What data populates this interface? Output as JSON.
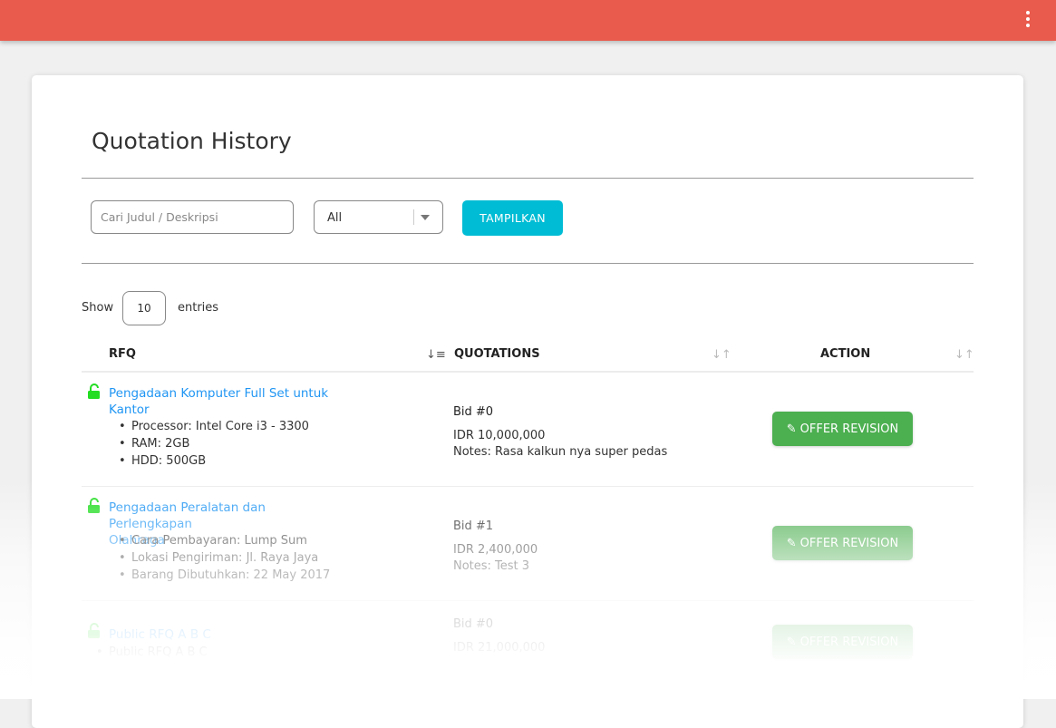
{
  "topbar": {
    "menu_icon": "kebab-menu-icon",
    "color": "#e95b4d"
  },
  "page": {
    "title": "Quotation History"
  },
  "filters": {
    "search_placeholder": "Cari Judul / Deskripsi",
    "status_select": "All",
    "submit_label": "TAMPILKAN"
  },
  "table_controls": {
    "show_label": "Show",
    "entries_value": "10",
    "entries_label": "entries"
  },
  "columns": {
    "rfq": "RFQ",
    "quotations": "QUOTATIONS",
    "action": "ACTION"
  },
  "rows": [
    {
      "rfq_title_line1": "Pengadaan Komputer Full Set untuk",
      "rfq_title_line2": "Kantor",
      "details": [
        "Processor: Intel Core i3 - 3300",
        "RAM: 2GB",
        "HDD: 500GB"
      ],
      "bid": "Bid #0",
      "amount": "IDR 10,000,000",
      "notes": "Notes: Rasa kalkun nya super pedas",
      "action": "OFFER REVISION"
    },
    {
      "rfq_title_line1": "Pengadaan Peralatan dan Perlengkapan",
      "rfq_title_line2": "Olahraga",
      "details": [
        "Cara Pembayaran: Lump Sum",
        "Lokasi Pengiriman: Jl. Raya Jaya",
        "Barang Dibutuhkan: 22 May 2017"
      ],
      "bid": "Bid #1",
      "amount": "IDR 2,400,000",
      "notes": "Notes: Test 3",
      "action": "OFFER REVISION"
    },
    {
      "rfq_title_line1": "Public RFQ A B C",
      "details": [
        "Public RFQ A B C"
      ],
      "bid": "Bid #0",
      "amount": "IDR 21,000,000",
      "action": "OFFER REVISION"
    }
  ],
  "colors": {
    "link": "#2196f3",
    "action_button": "#4caf50",
    "submit_button": "#00bcd4",
    "lock_icon": "#22dd22"
  }
}
